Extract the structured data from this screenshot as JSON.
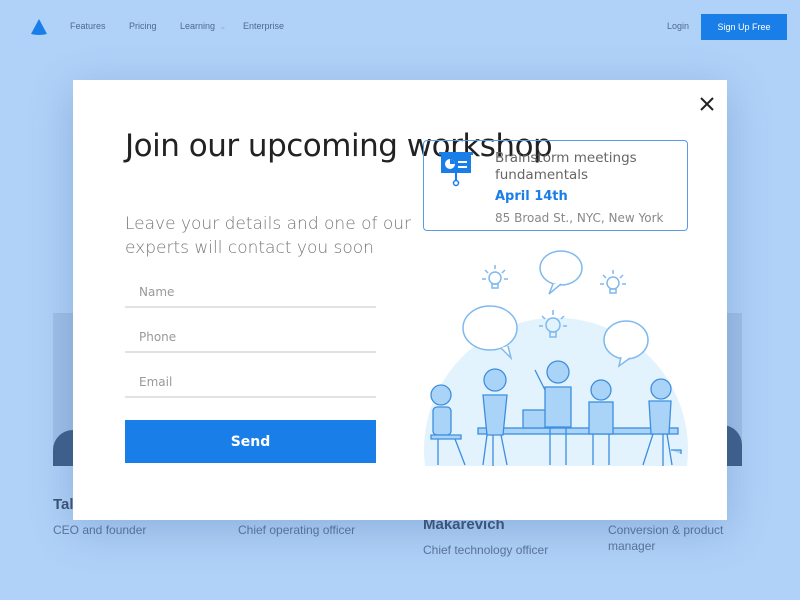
{
  "nav": {
    "links": [
      "Features",
      "Pricing",
      "Learning",
      "Enterprise"
    ],
    "login": "Login",
    "signup": "Sign Up Free"
  },
  "team": [
    {
      "name": "Tal",
      "role": "CEO and founder"
    },
    {
      "name": "",
      "role": "Chief operating officer"
    },
    {
      "name": "Makarevich",
      "role": "Chief technology officer"
    },
    {
      "name": "",
      "role": "Conversion & product manager"
    }
  ],
  "modal": {
    "title": "Join our upcoming workshop",
    "subtitle": "Leave your details and one of our experts will contact you soon",
    "fields": {
      "name": "Name",
      "phone": "Phone",
      "email": "Email"
    },
    "send": "Send",
    "event": {
      "title": "Brainstorm meetings fundamentals",
      "date": "April 14th",
      "address": "85 Broad St., NYC, New York",
      "icon": "presentation-board-icon"
    }
  },
  "colors": {
    "accent": "#1a7ee8",
    "background": "#b0d2f8"
  }
}
